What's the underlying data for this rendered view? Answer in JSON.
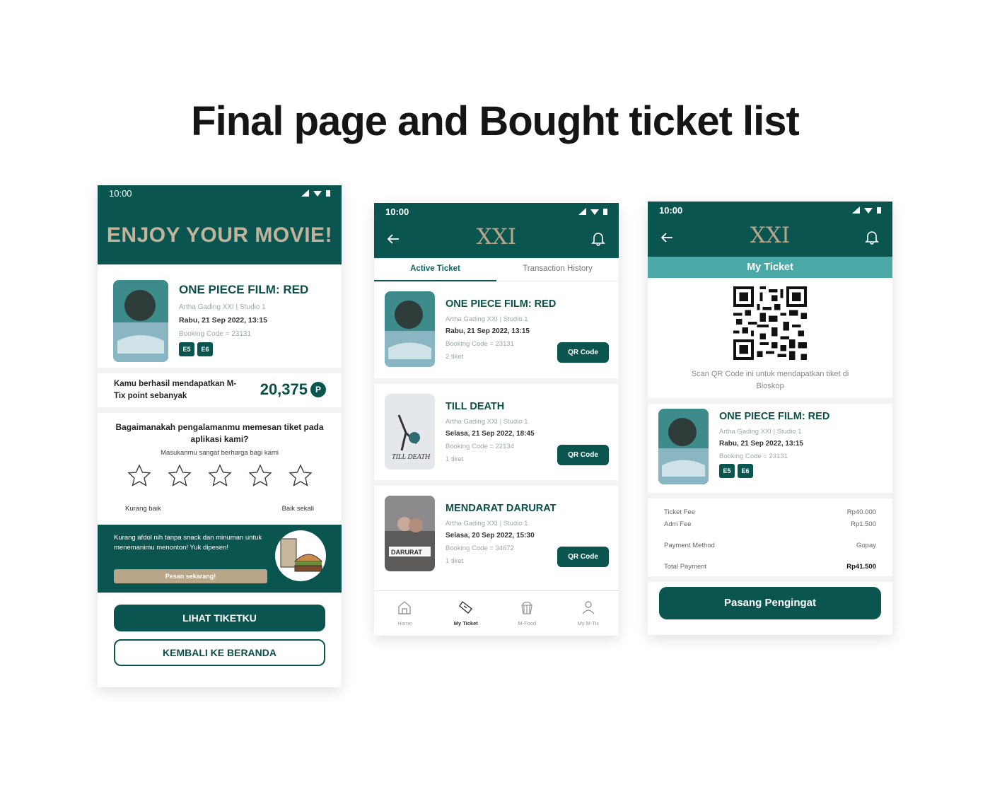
{
  "page_title": "Final page and Bought ticket list",
  "status_time": "10:00",
  "screen1": {
    "header": "ENJOY YOUR MOVIE!",
    "movie": {
      "title": "ONE PIECE FILM: RED",
      "venue": "Artha Gading XXI | Studio 1",
      "datetime": "Rabu, 21 Sep 2022, 13:15",
      "booking": "Booking Code = 23131",
      "seats": [
        "E5",
        "E6"
      ]
    },
    "points_text": "Kamu berhasil mendapatkan M-Tix point sebanyak",
    "points_value": "20,375",
    "points_icon": "P",
    "feedback_question": "Bagaimanakah pengalamanmu memesan tiket pada aplikasi kami?",
    "feedback_sub": "Masukanmu sangat berharga bagi kami",
    "rating_low": "Kurang baik",
    "rating_high": "Baik sekali",
    "rating_value": 0,
    "promo_text": "Kurang afdol nih tanpa snack dan minuman untuk menemanimu menonton! Yuk dipesen!",
    "promo_button": "Pesan sekarang!",
    "btn_tickets": "LIHAT TIKETKU",
    "btn_home": "KEMBALI KE BERANDA"
  },
  "screen2": {
    "logo": "XXI",
    "tabs": [
      "Active Ticket",
      "Transaction History"
    ],
    "tickets": [
      {
        "title": "ONE PIECE FILM: RED",
        "venue": "Artha Gading XXI | Studio 1",
        "datetime": "Rabu, 21 Sep 2022, 13:15",
        "booking": "Booking Code = 23131",
        "count": "2 tiket",
        "button": "QR Code"
      },
      {
        "title": "TILL DEATH",
        "venue": "Artha Gading XXI | Studio 1",
        "datetime": "Selasa, 21 Sep 2022, 18:45",
        "booking": "Booking Code = 22134",
        "count": "1 tiket",
        "button": "QR Code"
      },
      {
        "title": "MENDARAT DARURAT",
        "venue": "Artha Gading XXI | Studio 1",
        "datetime": "Selasa, 20 Sep 2022, 15:30",
        "booking": "Booking Code = 34672",
        "count": "1 tiket",
        "button": "QR Code"
      }
    ],
    "nav": [
      "Home",
      "My Ticket",
      "M-Food",
      "My M-Tix"
    ]
  },
  "screen3": {
    "logo": "XXI",
    "subheader": "My Ticket",
    "qr_caption": "Scan QR Code ini untuk mendapatkan tiket di Bioskop",
    "movie": {
      "title": "ONE PIECE FILM: RED",
      "venue": "Artha Gading XXI | Studio 1",
      "datetime": "Rabu, 21 Sep 2022, 13:15",
      "booking": "Booking Code = 23131",
      "seats": [
        "E5",
        "E6"
      ]
    },
    "fees": [
      {
        "label": "Ticket Fee",
        "value": "Rp40.000"
      },
      {
        "label": "Adm Fee",
        "value": "Rp1.500"
      }
    ],
    "payment_label": "Payment Method",
    "payment_value": "Gopay",
    "total_label": "Total Payment",
    "total_value": "Rp41.500",
    "button": "Pasang Pengingat"
  },
  "colors": {
    "primary": "#0b5550",
    "accent_teal": "#4aa9a6",
    "gold": "#b8a58a"
  }
}
